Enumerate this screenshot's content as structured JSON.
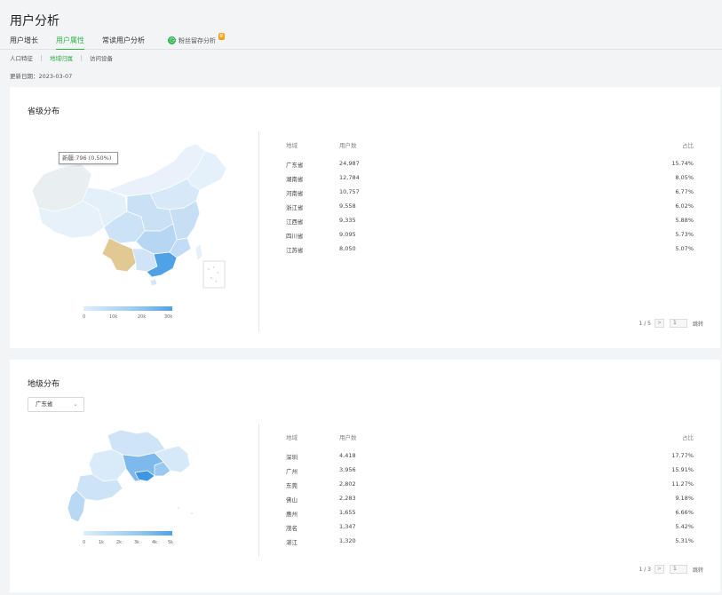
{
  "page": {
    "title": "用户分析"
  },
  "tabs": [
    {
      "label": "用户增长",
      "active": false
    },
    {
      "label": "用户属性",
      "active": true
    },
    {
      "label": "常读用户分析",
      "active": false
    },
    {
      "label": "粉丝留存分析",
      "active": false,
      "badge": "新"
    }
  ],
  "subtabs": [
    {
      "label": "人口特征",
      "active": false
    },
    {
      "label": "地域归属",
      "active": true
    },
    {
      "label": "访问设备",
      "active": false
    }
  ],
  "update": {
    "label": "更新日期：",
    "date": "2023-03-07"
  },
  "province": {
    "title": "省级分布",
    "tooltip": "新疆:796 (0.50%)",
    "legend_ticks": [
      "0",
      "10k",
      "20k",
      "30k"
    ],
    "table": {
      "headers": [
        "地域",
        "用户数",
        "占比"
      ],
      "rows": [
        [
          "广东省",
          "24,987",
          "15.74%"
        ],
        [
          "湖南省",
          "12,784",
          "8.05%"
        ],
        [
          "河南省",
          "10,757",
          "6.77%"
        ],
        [
          "浙江省",
          "9,558",
          "6.02%"
        ],
        [
          "江西省",
          "9,335",
          "5.88%"
        ],
        [
          "四川省",
          "9,095",
          "5.73%"
        ],
        [
          "江苏省",
          "8,050",
          "5.07%"
        ]
      ]
    },
    "pager": {
      "page_info": "1 / 5",
      "next": ">",
      "jump_value": "1",
      "jump_label": "跳转"
    }
  },
  "city": {
    "title": "地级分布",
    "select_value": "广东省",
    "legend_ticks": [
      "0",
      "1k",
      "2k",
      "3k",
      "4k",
      "5k"
    ],
    "table": {
      "headers": [
        "地域",
        "用户数",
        "占比"
      ],
      "rows": [
        [
          "深圳",
          "4,418",
          "17.77%"
        ],
        [
          "广州",
          "3,956",
          "15.91%"
        ],
        [
          "东莞",
          "2,802",
          "11.27%"
        ],
        [
          "佛山",
          "2,283",
          "9.18%"
        ],
        [
          "惠州",
          "1,655",
          "6.66%"
        ],
        [
          "茂名",
          "1,347",
          "5.42%"
        ],
        [
          "湛江",
          "1,320",
          "5.31%"
        ]
      ]
    },
    "pager": {
      "page_info": "1 / 3",
      "next": ">",
      "jump_value": "1",
      "jump_label": "跳转"
    }
  },
  "colors": {
    "accent": "#2eb24b",
    "map_high": "#4fa2e6",
    "map_low": "#e8f2fb",
    "highlight": "#e2c893"
  }
}
